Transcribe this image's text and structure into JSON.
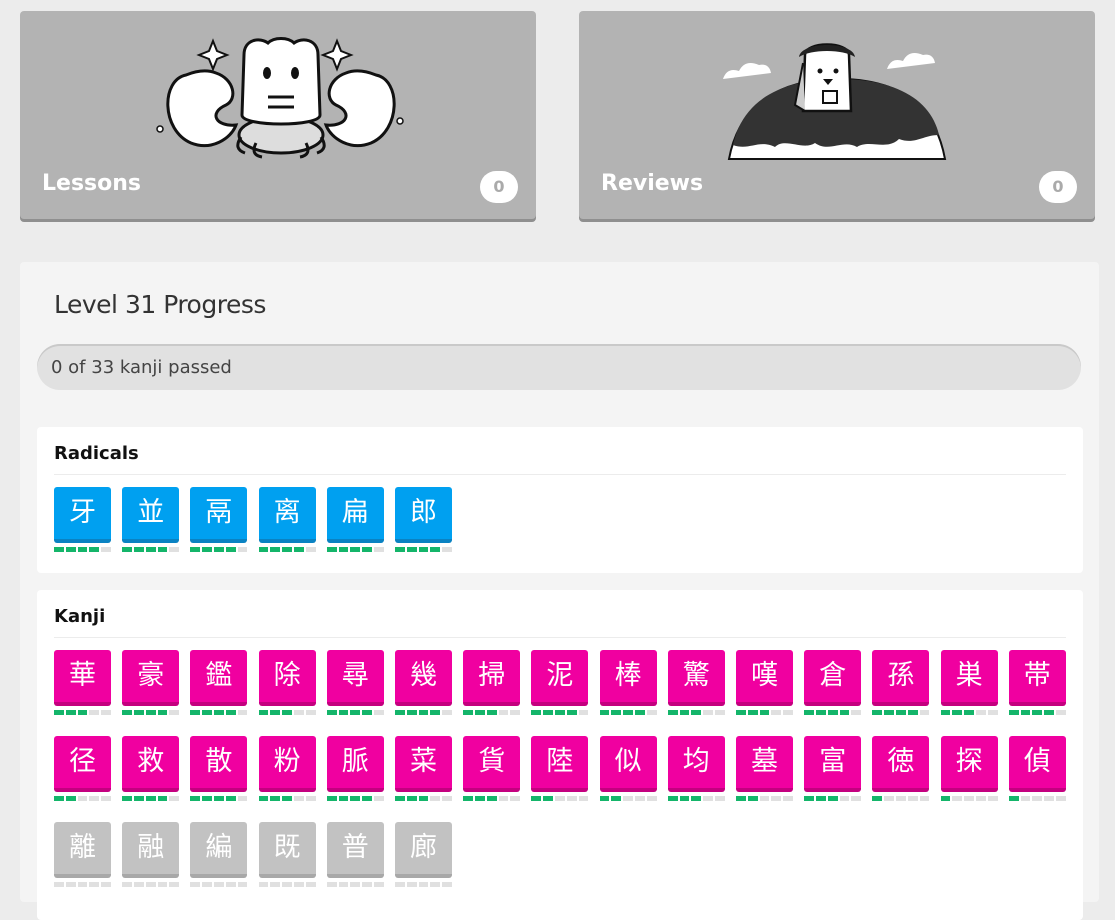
{
  "lessons": {
    "label": "Lessons",
    "count": "0"
  },
  "reviews": {
    "label": "Reviews",
    "count": "0"
  },
  "progress": {
    "title": "Level 31 Progress",
    "summary": "0 of 33 kanji passed",
    "passed_fraction": 0.0
  },
  "radicals": {
    "title": "Radicals",
    "items": [
      {
        "char": "牙",
        "stage": 4
      },
      {
        "char": "並",
        "stage": 4
      },
      {
        "char": "鬲",
        "stage": 4
      },
      {
        "char": "离",
        "stage": 4
      },
      {
        "char": "扁",
        "stage": 4
      },
      {
        "char": "郎",
        "stage": 4
      }
    ]
  },
  "kanji": {
    "title": "Kanji",
    "items": [
      {
        "char": "華",
        "stage": 3,
        "state": "unlocked"
      },
      {
        "char": "豪",
        "stage": 4,
        "state": "unlocked"
      },
      {
        "char": "鑑",
        "stage": 4,
        "state": "unlocked"
      },
      {
        "char": "除",
        "stage": 3,
        "state": "unlocked"
      },
      {
        "char": "尋",
        "stage": 4,
        "state": "unlocked"
      },
      {
        "char": "幾",
        "stage": 4,
        "state": "unlocked"
      },
      {
        "char": "掃",
        "stage": 3,
        "state": "unlocked"
      },
      {
        "char": "泥",
        "stage": 4,
        "state": "unlocked"
      },
      {
        "char": "棒",
        "stage": 4,
        "state": "unlocked"
      },
      {
        "char": "驚",
        "stage": 3,
        "state": "unlocked"
      },
      {
        "char": "嘆",
        "stage": 3,
        "state": "unlocked"
      },
      {
        "char": "倉",
        "stage": 4,
        "state": "unlocked"
      },
      {
        "char": "孫",
        "stage": 4,
        "state": "unlocked"
      },
      {
        "char": "巣",
        "stage": 3,
        "state": "unlocked"
      },
      {
        "char": "帯",
        "stage": 4,
        "state": "unlocked"
      },
      {
        "char": "径",
        "stage": 2,
        "state": "unlocked"
      },
      {
        "char": "救",
        "stage": 4,
        "state": "unlocked"
      },
      {
        "char": "散",
        "stage": 4,
        "state": "unlocked"
      },
      {
        "char": "粉",
        "stage": 3,
        "state": "unlocked"
      },
      {
        "char": "脈",
        "stage": 4,
        "state": "unlocked"
      },
      {
        "char": "菜",
        "stage": 3,
        "state": "unlocked"
      },
      {
        "char": "貨",
        "stage": 3,
        "state": "unlocked"
      },
      {
        "char": "陸",
        "stage": 2,
        "state": "unlocked"
      },
      {
        "char": "似",
        "stage": 2,
        "state": "unlocked"
      },
      {
        "char": "均",
        "stage": 3,
        "state": "unlocked"
      },
      {
        "char": "墓",
        "stage": 2,
        "state": "unlocked"
      },
      {
        "char": "富",
        "stage": 3,
        "state": "unlocked"
      },
      {
        "char": "徳",
        "stage": 1,
        "state": "unlocked"
      },
      {
        "char": "探",
        "stage": 1,
        "state": "unlocked"
      },
      {
        "char": "偵",
        "stage": 1,
        "state": "unlocked"
      },
      {
        "char": "離",
        "stage": 0,
        "state": "locked"
      },
      {
        "char": "融",
        "stage": 0,
        "state": "locked"
      },
      {
        "char": "編",
        "stage": 0,
        "state": "locked"
      },
      {
        "char": "既",
        "stage": 0,
        "state": "locked"
      },
      {
        "char": "普",
        "stage": 0,
        "state": "locked"
      },
      {
        "char": "廊",
        "stage": 0,
        "state": "locked"
      }
    ]
  },
  "colors": {
    "radical": "#00a0f0",
    "kanji": "#f000a0",
    "locked": "#c2c2c2",
    "srs_bar_on": "#14b56a"
  },
  "icons": {
    "lessons_illustration": "crab-mascot-icon",
    "reviews_illustration": "durtle-on-hill-icon"
  }
}
